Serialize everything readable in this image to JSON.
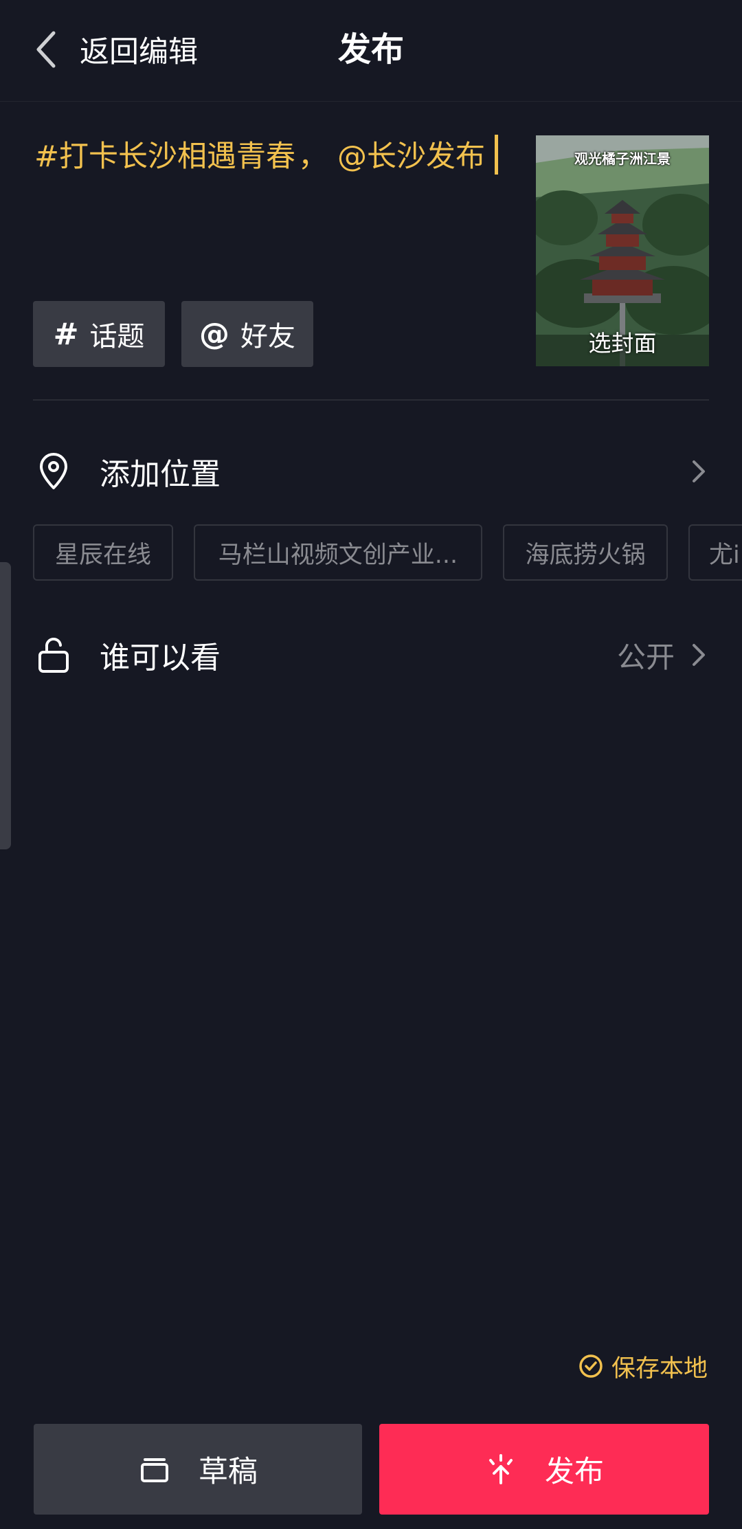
{
  "header": {
    "back_label": "返回编辑",
    "title": "发布"
  },
  "caption": {
    "hashtag": "#打卡长沙相遇青春",
    "separator": "，",
    "mention": "@长沙发布"
  },
  "cover": {
    "overlay_text": "观光橘子洲江景",
    "select_label": "选封面"
  },
  "chips": {
    "topic": {
      "symbol": "#",
      "label": "话题"
    },
    "friend": {
      "symbol": "@",
      "label": "好友"
    }
  },
  "location": {
    "label": "添加位置",
    "icon": "location-pin-icon",
    "suggestions": [
      "星辰在线",
      "马栏山视频文创产业...",
      "海底捞火锅",
      "尤il"
    ]
  },
  "visibility": {
    "label": "谁可以看",
    "value": "公开",
    "icon": "unlock-icon"
  },
  "save_local": {
    "label": "保存本地",
    "checked": true
  },
  "actions": {
    "draft_label": "草稿",
    "publish_label": "发布"
  },
  "colors": {
    "background": "#161823",
    "accent_yellow": "#f2c14e",
    "publish_red": "#fe2c55",
    "chip_gray": "#393b44"
  }
}
